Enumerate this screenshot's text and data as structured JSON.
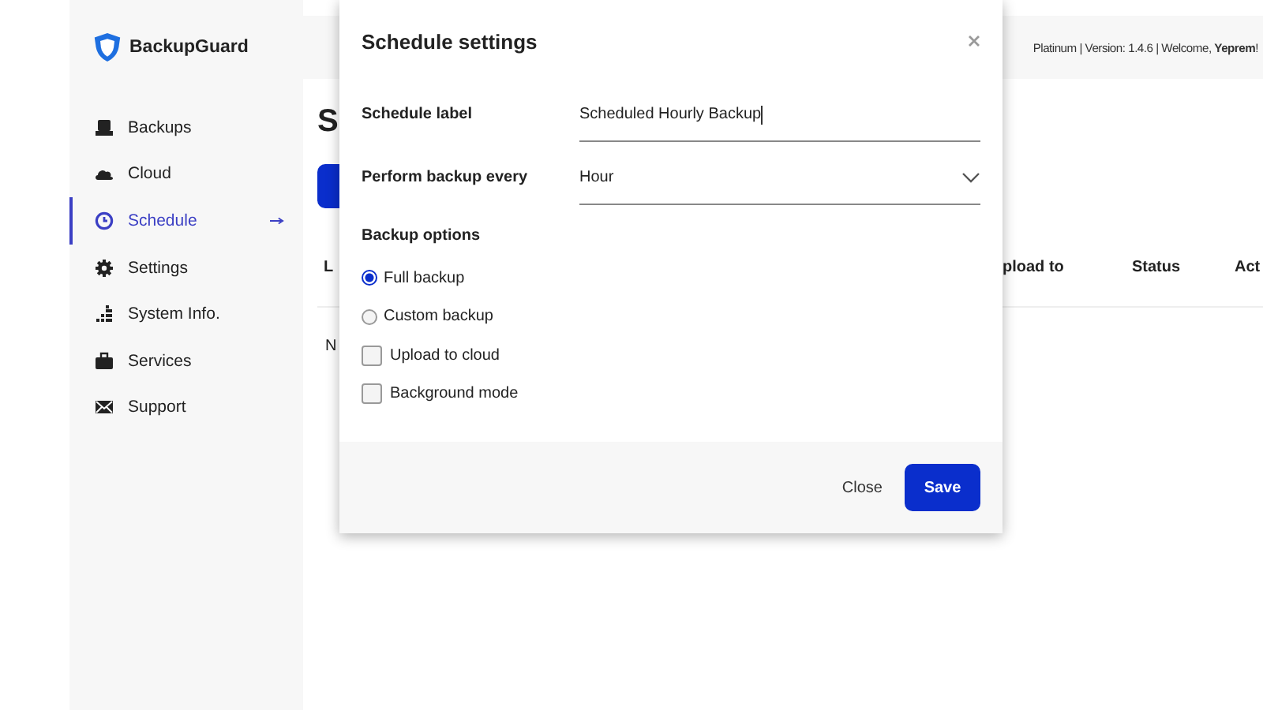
{
  "sidebar": {
    "logo": "BackupGuard",
    "items": [
      {
        "label": "Backups",
        "selected": false
      },
      {
        "label": "Cloud",
        "selected": false
      },
      {
        "label": "Schedule",
        "selected": true
      },
      {
        "label": "Settings",
        "selected": false
      },
      {
        "label": "System Info.",
        "selected": false
      },
      {
        "label": "Services",
        "selected": false
      },
      {
        "label": "Support",
        "selected": false
      }
    ]
  },
  "header": {
    "text": "Platinum | Version: 1.4.6 | Welcome, **Yeprem**!"
  },
  "page": {
    "heading": "S",
    "table": {
      "columns": [
        "L",
        "pload to",
        "Status",
        "Act"
      ],
      "rows": [
        [
          "N"
        ]
      ]
    }
  },
  "dialog": {
    "title": "Schedule settings",
    "fields": [
      {
        "kind": "text",
        "label": "Schedule label",
        "value": "Scheduled Hourly Backup"
      },
      {
        "kind": "select",
        "label": "Perform backup every",
        "value": "Hour"
      }
    ],
    "options_heading": "Backup options",
    "options": [
      {
        "kind": "radio",
        "label": "Full backup",
        "selected": true
      },
      {
        "kind": "radio",
        "label": "Custom backup",
        "selected": false
      },
      {
        "kind": "checkbox",
        "label": "Upload to cloud",
        "checked": false
      },
      {
        "kind": "checkbox",
        "label": "Background mode",
        "checked": false
      }
    ],
    "buttons": {
      "close": "Close",
      "save": "Save"
    }
  }
}
